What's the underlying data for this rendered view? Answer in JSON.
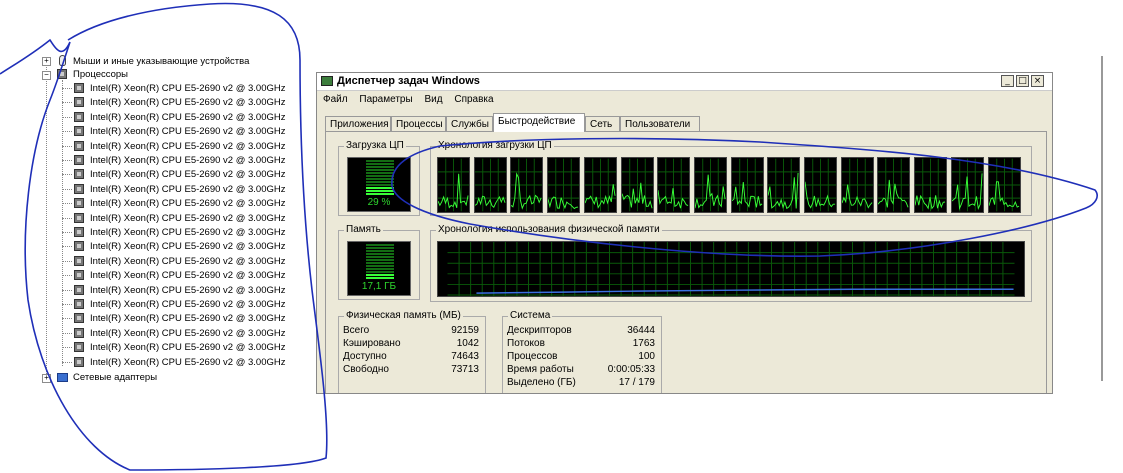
{
  "device_tree": {
    "mouse_category": "Мыши и иные указывающие устройства",
    "processors_category": "Процессоры",
    "cpu_items": [
      "Intel(R) Xeon(R) CPU E5-2690 v2 @ 3.00GHz",
      "Intel(R) Xeon(R) CPU E5-2690 v2 @ 3.00GHz",
      "Intel(R) Xeon(R) CPU E5-2690 v2 @ 3.00GHz",
      "Intel(R) Xeon(R) CPU E5-2690 v2 @ 3.00GHz",
      "Intel(R) Xeon(R) CPU E5-2690 v2 @ 3.00GHz",
      "Intel(R) Xeon(R) CPU E5-2690 v2 @ 3.00GHz",
      "Intel(R) Xeon(R) CPU E5-2690 v2 @ 3.00GHz",
      "Intel(R) Xeon(R) CPU E5-2690 v2 @ 3.00GHz",
      "Intel(R) Xeon(R) CPU E5-2690 v2 @ 3.00GHz",
      "Intel(R) Xeon(R) CPU E5-2690 v2 @ 3.00GHz",
      "Intel(R) Xeon(R) CPU E5-2690 v2 @ 3.00GHz",
      "Intel(R) Xeon(R) CPU E5-2690 v2 @ 3.00GHz",
      "Intel(R) Xeon(R) CPU E5-2690 v2 @ 3.00GHz",
      "Intel(R) Xeon(R) CPU E5-2690 v2 @ 3.00GHz",
      "Intel(R) Xeon(R) CPU E5-2690 v2 @ 3.00GHz",
      "Intel(R) Xeon(R) CPU E5-2690 v2 @ 3.00GHz",
      "Intel(R) Xeon(R) CPU E5-2690 v2 @ 3.00GHz",
      "Intel(R) Xeon(R) CPU E5-2690 v2 @ 3.00GHz",
      "Intel(R) Xeon(R) CPU E5-2690 v2 @ 3.00GHz",
      "Intel(R) Xeon(R) CPU E5-2690 v2 @ 3.00GHz"
    ],
    "network_category": "Сетевые адаптеры"
  },
  "task_manager": {
    "title": "Диспетчер задач Windows",
    "window_buttons": {
      "minimize": "_",
      "maximize": "□",
      "close": "×"
    },
    "menu": [
      "Файл",
      "Параметры",
      "Вид",
      "Справка"
    ],
    "tabs": [
      "Приложения",
      "Процессы",
      "Службы",
      "Быстродействие",
      "Сеть",
      "Пользователи"
    ],
    "active_tab": "Быстродействие",
    "cpu_usage": {
      "label": "Загрузка ЦП",
      "value_text": "29 %",
      "level": 0.29
    },
    "cpu_history": {
      "label": "Хронология загрузки ЦП",
      "graph_count": 16
    },
    "memory": {
      "label": "Память",
      "value_text": "17,1 ГБ",
      "level": 0.19
    },
    "memory_history": {
      "label": "Хронология использования физической памяти"
    },
    "physical_memory": {
      "label": "Физическая память (МБ)",
      "rows": [
        {
          "name": "Всего",
          "value": "92159"
        },
        {
          "name": "Кэшировано",
          "value": "1042"
        },
        {
          "name": "Доступно",
          "value": "74643"
        },
        {
          "name": "Свободно",
          "value": "73713"
        }
      ]
    },
    "system": {
      "label": "Система",
      "rows": [
        {
          "name": "Дескрипторов",
          "value": "36444"
        },
        {
          "name": "Потоков",
          "value": "1763"
        },
        {
          "name": "Процессов",
          "value": "100"
        },
        {
          "name": "Время работы",
          "value": "0:00:05:33"
        },
        {
          "name": "Выделено (ГБ)",
          "value": "17 / 179"
        }
      ]
    }
  },
  "colors": {
    "graph_green": "#38ff38",
    "grid_green": "#0a5a0a",
    "memory_line": "#3a6fe0",
    "ink": "#1f2fb8"
  }
}
